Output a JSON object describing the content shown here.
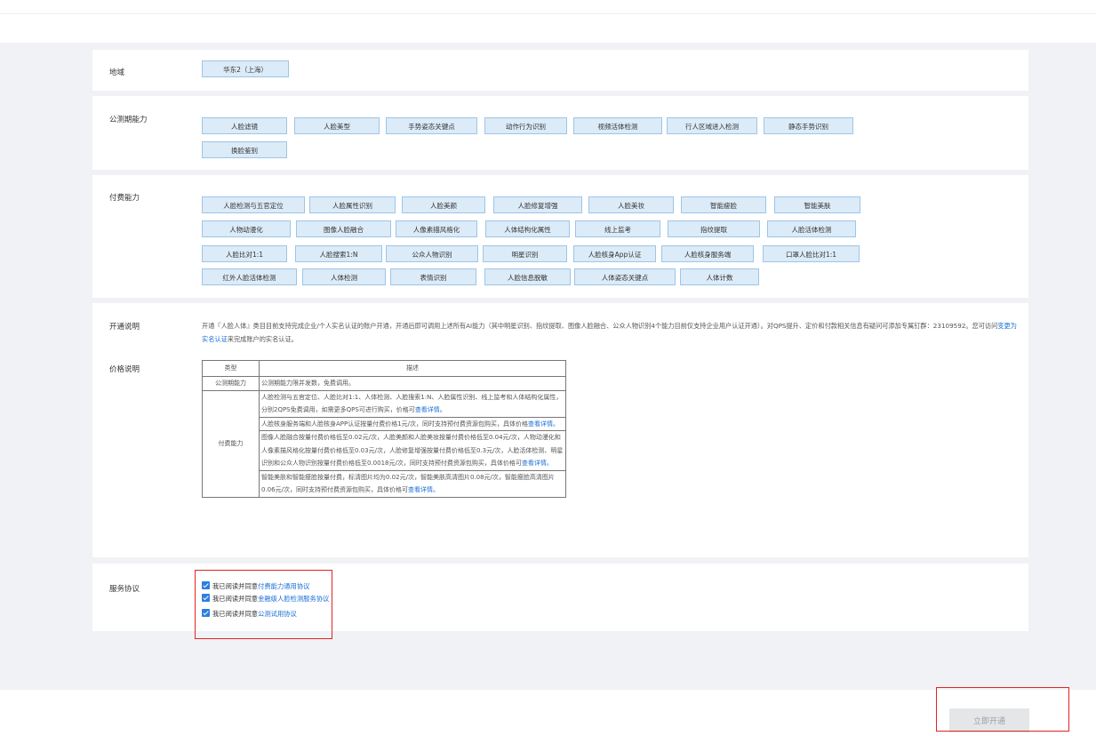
{
  "region": {
    "label": "地域",
    "value": "华东2（上海）"
  },
  "beta_abilities": {
    "label": "公测期能力",
    "items": [
      "人脸滤镜",
      "人脸美型",
      "手势姿态关键点",
      "动作行为识别",
      "视频活体检测",
      "行人区域进入检测",
      "静态手势识别",
      "换脸鉴别"
    ]
  },
  "paid_abilities": {
    "label": "付费能力",
    "items": [
      "人脸检测与五官定位",
      "人脸属性识别",
      "人脸美颜",
      "人脸修复增强",
      "人脸美妆",
      "智能瘦脸",
      "智能美肤",
      "人物动漫化",
      "图像人脸融合",
      "人像素描风格化",
      "人体结构化属性",
      "线上监考",
      "指纹提取",
      "人脸活体检测",
      "人脸比对1:1",
      "人脸搜索1:N",
      "公众人物识别",
      "明星识别",
      "人脸核身App认证",
      "人脸核身服务端",
      "口罩人脸比对1:1",
      "红外人脸活体检测",
      "人体检测",
      "表情识别",
      "人脸信息脱敏",
      "人体姿态关键点",
      "人体计数"
    ]
  },
  "activation": {
    "label": "开通说明",
    "text_1": "开通『人脸人体』类目目前支持完成企业/个人实名认证的账户开通，开通后即可调用上述所有AI能力（其中明星识别、指纹提取、图像人脸融合、公众人物识别4个能力目前仅支持企业用户认证开通）。对QPS提升、定价和付款相关信息有疑问可添加专属钉群：23109592。您可访问",
    "link": "变更为实名认证",
    "text_2": "来完成账户的实名认证。"
  },
  "pricing": {
    "label": "价格说明",
    "header_type": "类型",
    "header_desc": "描述",
    "beta_type": "公测期能力",
    "beta_desc": "公测期能力限并发数，免费调用。",
    "paid_type": "付费能力",
    "paid_row_1": "人脸检测与五官定位、人脸比对1:1、人体检测、人脸搜索1:N、人脸属性识别、线上监考和人体结构化属性，分别2QPS免费调用，如需更多QPS可进行购买，价格可",
    "paid_row_2": "人脸核身服务端和人脸核身APP认证按量付费价格1元/次，同时支持预付费资源包购买，具体价格",
    "paid_row_3": "图像人脸融合按量付费价格低至0.02元/次，人脸美颜和人脸美妆按量付费价格低至0.04元/次，人物动漫化和人像素描风格化按量付费价格低至0.03元/次，人脸修复增强按量付费价格低至0.3元/次，人脸活体检测、明星识别和公众人物识别按量付费价格低至0.0018元/次，同时支持预付费资源包购买，具体价格可",
    "paid_row_4": "智能美肤和智能瘦脸按量付费，标清图片均为0.02元/次，智能美肤高清图片0.08元/次，智能瘦脸高清图片0.06元/次，同时支持预付费资源包购买，具体价格可",
    "details_link": "查看详情。"
  },
  "agreement": {
    "label": "服务协议",
    "prefix": "我已阅读并同意",
    "items": [
      "付费能力通用协议",
      "金融级人脸检测服务协议",
      "公测试用协议"
    ]
  },
  "submit_label": "立即开通",
  "colors": {
    "chip_bg": "#dcebf8",
    "chip_border": "#9cc6e8",
    "link": "#1a6fd6",
    "highlight": "#e02424"
  }
}
